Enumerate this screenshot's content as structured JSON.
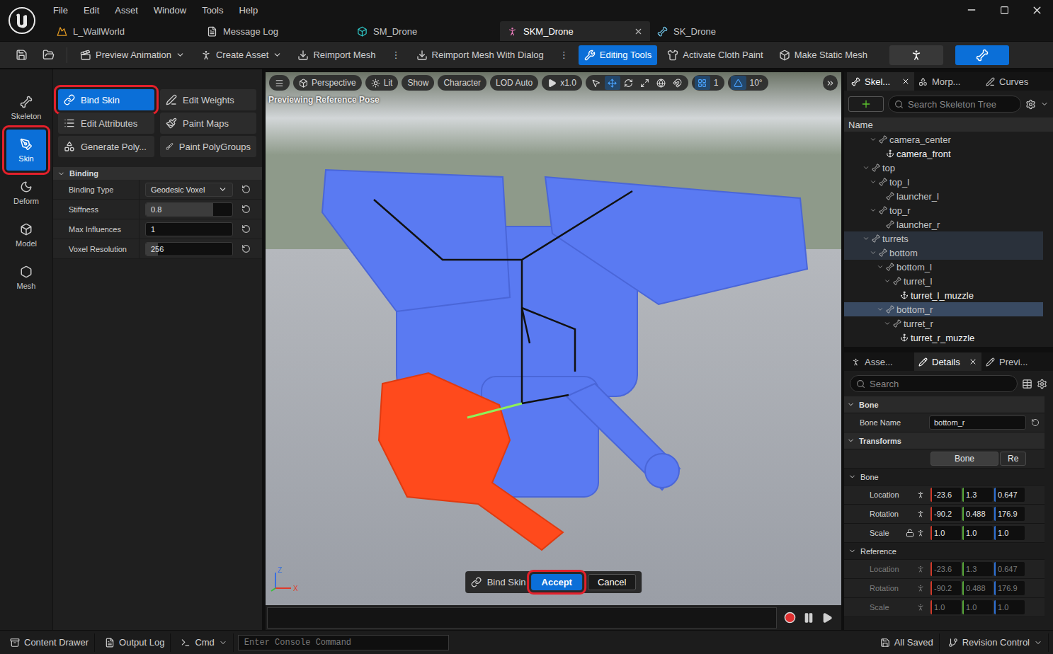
{
  "menu": [
    "File",
    "Edit",
    "Asset",
    "Window",
    "Tools",
    "Help"
  ],
  "tabs": [
    {
      "label": "L_WallWorld",
      "selected": false,
      "kind": "level"
    },
    {
      "label": "Message Log",
      "selected": false,
      "kind": "log"
    },
    {
      "label": "SM_Drone",
      "selected": false,
      "kind": "static"
    },
    {
      "label": "SKM_Drone",
      "selected": true,
      "kind": "skeletal"
    },
    {
      "label": "SK_Drone",
      "selected": false,
      "kind": "skeleton"
    }
  ],
  "toolbar": [
    {
      "label": "Preview Animation",
      "kind": "anim",
      "dropdown": true,
      "active": false
    },
    {
      "label": "Create Asset",
      "kind": "create",
      "dropdown": true,
      "active": false
    },
    {
      "label": "Reimport Mesh",
      "kind": "reimport",
      "dropdown": false,
      "active": false
    },
    {
      "label": "⋮",
      "kind": "more",
      "dropdown": false,
      "active": false
    },
    {
      "label": "Reimport Mesh With Dialog",
      "kind": "reimport",
      "dropdown": false,
      "active": false
    },
    {
      "label": "⋮",
      "kind": "more",
      "dropdown": false,
      "active": false
    },
    {
      "label": "Editing Tools",
      "kind": "tools",
      "dropdown": false,
      "active": true
    },
    {
      "label": "Activate Cloth Paint",
      "kind": "cloth",
      "dropdown": false,
      "active": false
    },
    {
      "label": "Make Static Mesh",
      "kind": "static",
      "dropdown": false,
      "active": false
    }
  ],
  "mode_buttons": [
    {
      "kind": "skeleton",
      "selected": false
    },
    {
      "kind": "mesh",
      "selected": true
    }
  ],
  "modes": [
    {
      "label": "Skeleton",
      "kind": "skeleton",
      "selected": false,
      "annotated": false
    },
    {
      "label": "Skin",
      "kind": "skin",
      "selected": true,
      "annotated": true
    },
    {
      "label": "Deform",
      "kind": "deform",
      "selected": false,
      "annotated": false
    },
    {
      "label": "Model",
      "kind": "model",
      "selected": false,
      "annotated": false
    },
    {
      "label": "Mesh",
      "kind": "mesh",
      "selected": false,
      "annotated": false
    }
  ],
  "tools": [
    {
      "label": "Bind Skin",
      "kind": "bind",
      "selected": true,
      "annotated": true
    },
    {
      "label": "Edit Weights",
      "kind": "weights",
      "selected": false,
      "annotated": false
    },
    {
      "label": "Edit Attributes",
      "kind": "attributes",
      "selected": false,
      "annotated": false
    },
    {
      "label": "Paint Maps",
      "kind": "paint",
      "selected": false,
      "annotated": false
    },
    {
      "label": "Generate Poly...",
      "kind": "generate",
      "selected": false,
      "annotated": false
    },
    {
      "label": "Paint PolyGroups",
      "kind": "polygroups",
      "selected": false,
      "annotated": false
    }
  ],
  "binding": {
    "title": "Binding",
    "expanded": true,
    "properties": [
      {
        "label": "Binding Type",
        "kind": "dropdown",
        "value": "Geodesic Voxel"
      },
      {
        "label": "Stiffness",
        "kind": "slider",
        "value": "0.8",
        "level": 0.78
      },
      {
        "label": "Max Influences",
        "kind": "number",
        "value": "1"
      },
      {
        "label": "Voxel Resolution",
        "kind": "slider",
        "value": "256",
        "level": 0.14
      }
    ]
  },
  "viewport": {
    "toolbar": [
      {
        "label": "Perspective",
        "kind": "camera"
      },
      {
        "label": "Lit",
        "kind": "lit"
      },
      {
        "label": "Show",
        "kind": "plain"
      },
      {
        "label": "Character",
        "kind": "plain"
      },
      {
        "label": "LOD Auto",
        "kind": "plain"
      },
      {
        "label": "x1.0",
        "kind": "play"
      }
    ],
    "transform_tools": [
      {
        "kind": "select",
        "selected": false
      },
      {
        "kind": "move",
        "selected": true
      },
      {
        "kind": "rotate",
        "selected": false
      },
      {
        "kind": "scale",
        "selected": false
      },
      {
        "kind": "world",
        "selected": false
      },
      {
        "kind": "snap",
        "selected": false
      }
    ],
    "grid": {
      "value": "1",
      "on": true
    },
    "angle": {
      "value": "10°",
      "on": true
    },
    "status": "Previewing Reference Pose",
    "gizmo": [
      "Z",
      "X"
    ],
    "action_bar": {
      "label": "Bind Skin",
      "buttons": [
        {
          "label": "Accept",
          "primary": true,
          "annotated": true
        },
        {
          "label": "Cancel",
          "primary": false,
          "annotated": false
        }
      ]
    }
  },
  "skeleton_panel": {
    "tabs": [
      {
        "label": "Skel...",
        "selected": true,
        "closable": true,
        "kind": "skeleton"
      },
      {
        "label": "Morp...",
        "selected": false,
        "closable": false,
        "kind": "morph"
      },
      {
        "label": "Curves",
        "selected": false,
        "closable": false,
        "kind": "curves"
      }
    ],
    "search_placeholder": "Search Skeleton Tree",
    "column": "Name",
    "rows": [
      {
        "name": "camera_center",
        "depth": 2,
        "expanded": true,
        "kind": "bone",
        "selected": false,
        "highlighted": false
      },
      {
        "name": "camera_front",
        "depth": 3,
        "expanded": false,
        "kind": "socket",
        "selected": false,
        "highlighted": false
      },
      {
        "name": "top",
        "depth": 1,
        "expanded": true,
        "kind": "bone",
        "selected": false,
        "highlighted": false
      },
      {
        "name": "top_l",
        "depth": 2,
        "expanded": true,
        "kind": "bone",
        "selected": false,
        "highlighted": false
      },
      {
        "name": "launcher_l",
        "depth": 3,
        "expanded": false,
        "kind": "bone",
        "selected": false,
        "highlighted": false
      },
      {
        "name": "top_r",
        "depth": 2,
        "expanded": true,
        "kind": "bone",
        "selected": false,
        "highlighted": false
      },
      {
        "name": "launcher_r",
        "depth": 3,
        "expanded": false,
        "kind": "bone",
        "selected": false,
        "highlighted": false
      },
      {
        "name": "turrets",
        "depth": 1,
        "expanded": true,
        "kind": "bone",
        "selected": false,
        "highlighted": true
      },
      {
        "name": "bottom",
        "depth": 2,
        "expanded": true,
        "kind": "bone",
        "selected": false,
        "highlighted": true
      },
      {
        "name": "bottom_l",
        "depth": 3,
        "expanded": true,
        "kind": "bone",
        "selected": false,
        "highlighted": false
      },
      {
        "name": "turret_l",
        "depth": 4,
        "expanded": true,
        "kind": "bone",
        "selected": false,
        "highlighted": false
      },
      {
        "name": "turret_l_muzzle",
        "depth": 5,
        "expanded": false,
        "kind": "socket",
        "selected": false,
        "highlighted": false
      },
      {
        "name": "bottom_r",
        "depth": 3,
        "expanded": true,
        "kind": "bone",
        "selected": true,
        "highlighted": false
      },
      {
        "name": "turret_r",
        "depth": 4,
        "expanded": true,
        "kind": "bone",
        "selected": false,
        "highlighted": false
      },
      {
        "name": "turret_r_muzzle",
        "depth": 5,
        "expanded": false,
        "kind": "socket",
        "selected": false,
        "highlighted": false
      }
    ]
  },
  "details_panel": {
    "tabs": [
      {
        "label": "Asse...",
        "selected": false,
        "closable": false,
        "kind": "asset"
      },
      {
        "label": "Details",
        "selected": true,
        "closable": true,
        "kind": "details"
      },
      {
        "label": "Previ...",
        "selected": false,
        "closable": false,
        "kind": "preview"
      }
    ],
    "search_placeholder": "Search",
    "bone_section": {
      "title": "Bone",
      "expanded": true,
      "fields": [
        {
          "label": "Bone Name",
          "value": "bottom_r"
        }
      ]
    },
    "transforms": {
      "title": "Transforms",
      "expanded": true,
      "toggle": [
        {
          "label": "Bone",
          "selected": true
        },
        {
          "label": "Re",
          "selected": false
        }
      ],
      "groups": [
        {
          "title": "Bone",
          "expanded": true,
          "disabled": false,
          "rows": [
            {
              "label": "Location",
              "values": [
                "-23.6",
                "1.3",
                "0.647"
              ],
              "lockable": false
            },
            {
              "label": "Rotation",
              "values": [
                "-90.2",
                "0.488",
                "176.9"
              ],
              "lockable": false
            },
            {
              "label": "Scale",
              "values": [
                "1.0",
                "1.0",
                "1.0"
              ],
              "lockable": true
            }
          ]
        },
        {
          "title": "Reference",
          "expanded": true,
          "disabled": true,
          "rows": [
            {
              "label": "Location",
              "values": [
                "-23.6",
                "1.3",
                "0.647"
              ],
              "lockable": false
            },
            {
              "label": "Rotation",
              "values": [
                "-90.2",
                "0.488",
                "176.9"
              ],
              "lockable": false
            },
            {
              "label": "Scale",
              "values": [
                "1.0",
                "1.0",
                "1.0"
              ],
              "lockable": false
            }
          ]
        }
      ]
    }
  },
  "status_bar": {
    "left": [
      {
        "label": "Content Drawer",
        "kind": "drawer",
        "dropdown": false
      },
      {
        "label": "Output Log",
        "kind": "log",
        "dropdown": false
      },
      {
        "label": "Cmd",
        "kind": "cmd",
        "dropdown": true
      }
    ],
    "console_placeholder": "Enter Console Command",
    "right": [
      {
        "label": "All Saved",
        "kind": "saved",
        "dropdown": false
      },
      {
        "label": "Revision Control",
        "kind": "revision",
        "dropdown": true
      }
    ]
  }
}
